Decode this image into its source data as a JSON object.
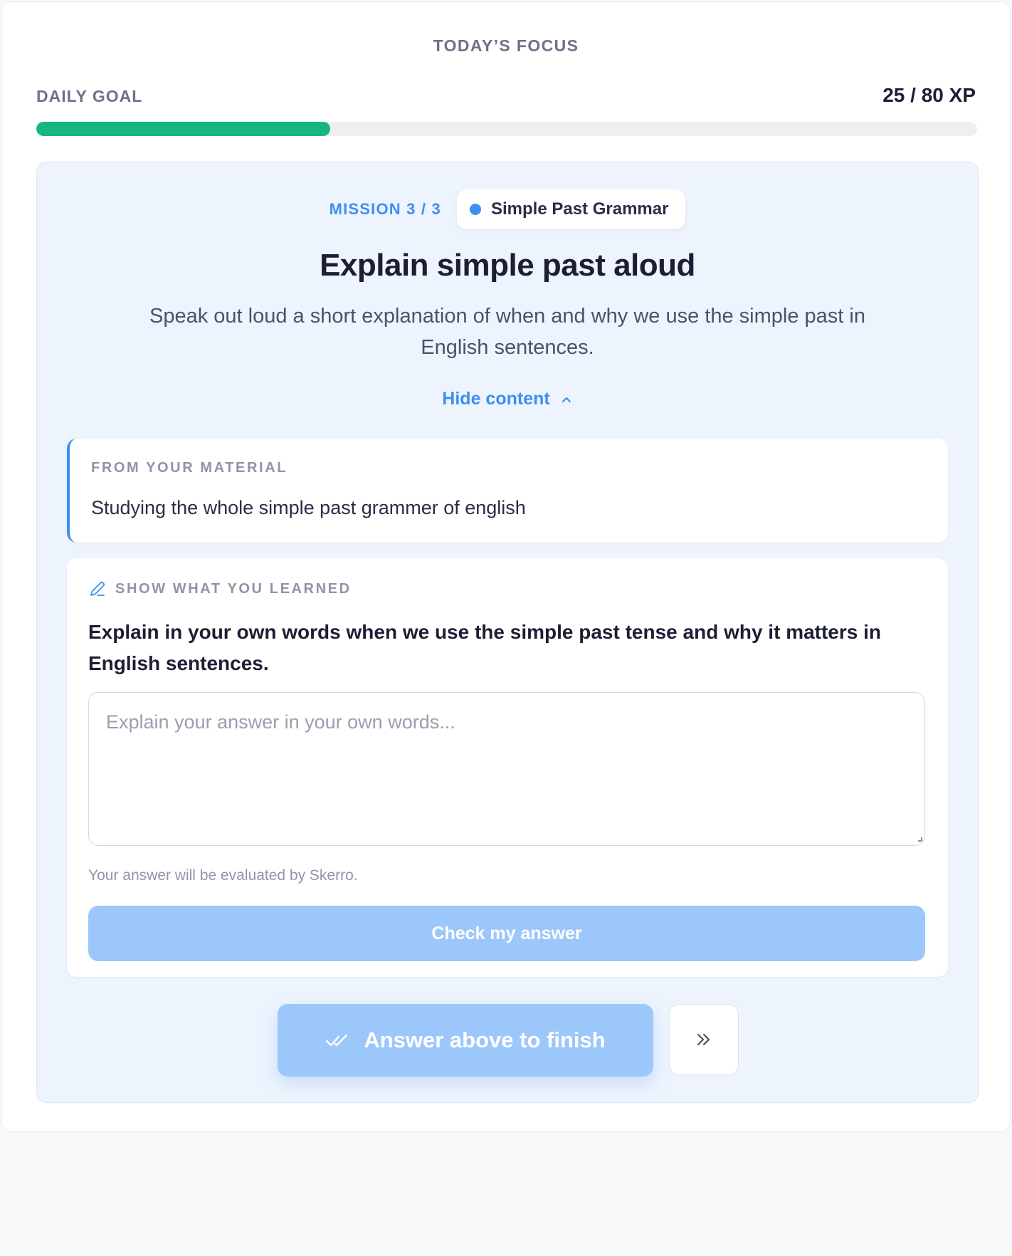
{
  "header": {
    "focus_title": "TODAY’S FOCUS"
  },
  "daily_goal": {
    "label": "DAILY GOAL",
    "xp_text": "25 / 80 XP",
    "current_xp": 25,
    "target_xp": 80,
    "progress_fraction": 0.3125,
    "progress_color": "#17b584"
  },
  "mission": {
    "count_text": "MISSION 3 / 3",
    "topic": "Simple Past Grammar",
    "title": "Explain simple past aloud",
    "description": "Speak out loud a short explanation of when and why we use the simple past in English sentences.",
    "toggle_label": "Hide content",
    "accent_color": "#3f8ef2"
  },
  "material": {
    "heading": "FROM YOUR MATERIAL",
    "text": "Studying the whole simple past grammer of english"
  },
  "learned": {
    "heading": "SHOW WHAT YOU LEARNED",
    "heading_icon": "pencil-icon",
    "question": "Explain in your own words when we use the simple past tense and why it matters in English sentences.",
    "answer_placeholder": "Explain your answer in your own words...",
    "answer_value": "",
    "eval_note": "Your answer will be evaluated by Skerro.",
    "check_button_label": "Check my answer"
  },
  "actions": {
    "finish_label": "Answer above to finish",
    "finish_icon": "double-check-icon",
    "skip_icon": "double-chevron-right-icon"
  }
}
